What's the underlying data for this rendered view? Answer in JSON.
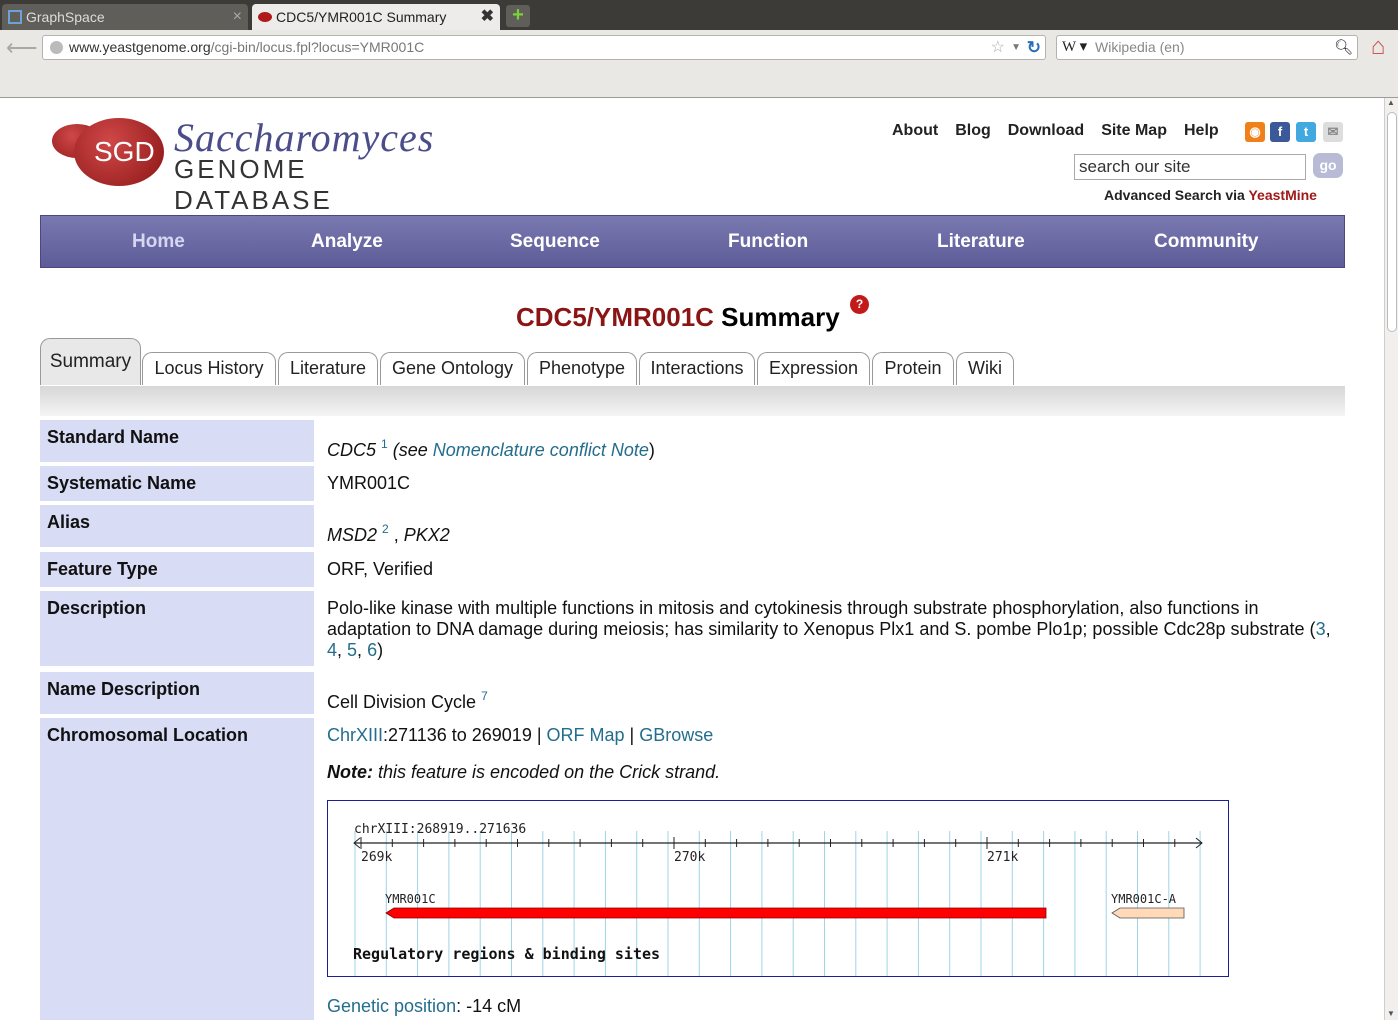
{
  "browser": {
    "tabs": [
      {
        "title": "GraphSpace"
      },
      {
        "title": "CDC5/YMR001C Summary"
      }
    ],
    "url_domain": "www.yeastgenome.org",
    "url_path": "/cgi-bin/locus.fpl?locus=YMR001C",
    "search_engine_placeholder": "Wikipedia (en)"
  },
  "header": {
    "logo_abbrev": "SGD",
    "logo_title": "Saccharomyces",
    "logo_subtitle": "GENOME DATABASE",
    "links": [
      "About",
      "Blog",
      "Download",
      "Site Map",
      "Help"
    ],
    "site_search_placeholder": "search our site",
    "go_label": "go",
    "advanced_prefix": "Advanced Search via ",
    "advanced_link": "YeastMine"
  },
  "nav": [
    "Home",
    "Analyze",
    "Sequence",
    "Function",
    "Literature",
    "Community"
  ],
  "title": {
    "gene": "CDC5/YMR001C",
    "suffix": " Summary",
    "help": "?"
  },
  "tabs": [
    "Summary",
    "Locus History",
    "Literature",
    "Gene Ontology",
    "Phenotype",
    "Interactions",
    "Expression",
    "Protein",
    "Wiki"
  ],
  "rows": {
    "standard_name": {
      "label": "Standard Name",
      "name": "CDC5",
      "ref": "1",
      "see_prefix": " (see ",
      "link": "Nomenclature conflict Note",
      "see_suffix": ")"
    },
    "systematic_name": {
      "label": "Systematic Name",
      "value": "YMR001C"
    },
    "alias": {
      "label": "Alias",
      "a1": "MSD2",
      "ref": "2",
      "sep": " , ",
      "a2": "PKX2"
    },
    "feature_type": {
      "label": "Feature Type",
      "value": "ORF, Verified"
    },
    "description": {
      "label": "Description",
      "text": "Polo-like kinase with multiple functions in mitosis and cytokinesis through substrate phosphorylation, also functions in adaptation to DNA damage during meiosis; has similarity to Xenopus Plx1 and S. pombe Plo1p; possible Cdc28p substrate (",
      "r3": "3",
      "r4": "4",
      "r5": "5",
      "r6": "6",
      "close": ")"
    },
    "name_description": {
      "label": "Name Description",
      "value": "Cell Division Cycle",
      "ref": "7"
    },
    "chromosomal_location": {
      "label": "Chromosomal Location",
      "chr_link": "ChrXIII",
      "coords": ":271136 to 269019 | ",
      "orf_map": "ORF Map",
      "pipe": " | ",
      "gbrowse": "GBrowse",
      "note_label": "Note:",
      "note_text": " this feature is encoded on the Crick strand."
    }
  },
  "genome_view": {
    "region_label": "chrXIII:268919..271636",
    "ticks": [
      "269k",
      "270k",
      "271k"
    ],
    "features": [
      {
        "name": "YMR001C",
        "color": "#ff0000"
      },
      {
        "name": "YMR001C-A",
        "color": "#ffd9b8"
      }
    ],
    "track_title": "Regulatory regions & binding sites"
  },
  "genetic_position": {
    "link": "Genetic position",
    "value": ": -14 cM"
  }
}
